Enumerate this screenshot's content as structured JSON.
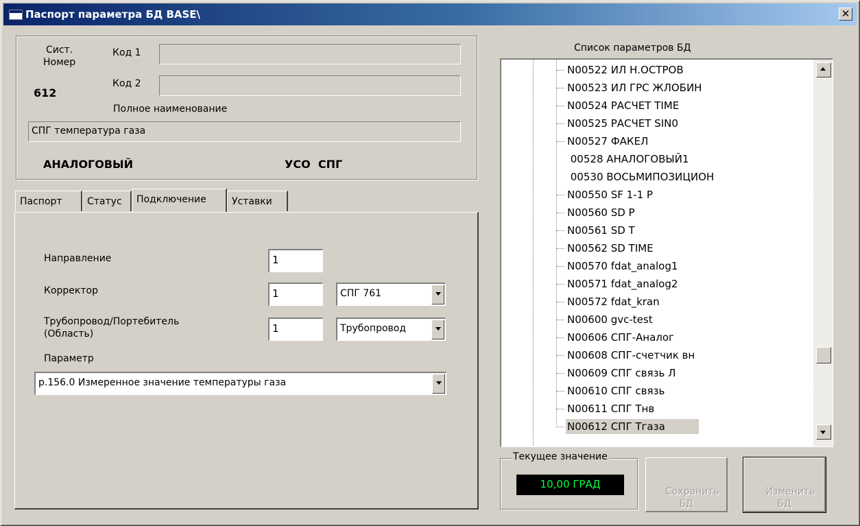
{
  "window": {
    "title": "Паспорт параметра БД BASE\\",
    "close_glyph": "✕",
    "title_icon": "window-icon"
  },
  "header": {
    "sys_number_label": "Сист.\nНомер",
    "sys_number_value": "612",
    "code1_label": "Код 1",
    "code1_value": "",
    "code2_label": "Код 2",
    "code2_value": "",
    "full_name_label": "Полное наименование",
    "full_name_value": "СПГ температура газа",
    "type_text": "АНАЛОГОВЫЙ",
    "uso_text": "УСО  СПГ"
  },
  "tabs": [
    {
      "label": "Паспорт",
      "active": false
    },
    {
      "label": "Статус",
      "active": false
    },
    {
      "label": "Подключение",
      "active": true
    },
    {
      "label": "Уставки",
      "active": false
    }
  ],
  "connection": {
    "direction_label": "Направление",
    "direction_value": "1",
    "corrector_label": "Корректор",
    "corrector_value": "1",
    "corrector_select": "СПГ 761",
    "pipeline_label": "Трубопровод/Портебитель\n(Область)",
    "pipeline_value": "1",
    "pipeline_select": "Трубопровод",
    "parameter_label": "Параметр",
    "parameter_select": "p.156.0 Измеренное значение температуры газа"
  },
  "param_list": {
    "title": "Список параметров БД",
    "items": [
      {
        "label": "N00522 ИЛ Н.ОСТРОВ",
        "dash": true
      },
      {
        "label": "N00523 ИЛ ГРС ЖЛОБИН",
        "dash": true
      },
      {
        "label": "N00524 РАСЧЕТ TIME",
        "dash": true
      },
      {
        "label": "N00525 РАСЧЕТ SIN0",
        "dash": true
      },
      {
        "label": "N00527 ФАКЕЛ",
        "dash": true
      },
      {
        "label": " 00528 АНАЛОГОВЫЙ1",
        "dash": false
      },
      {
        "label": " 00530 ВОСЬМИПОЗИЦИОН",
        "dash": false
      },
      {
        "label": "N00550 SF 1-1 P",
        "dash": true
      },
      {
        "label": "N00560 SD P",
        "dash": true
      },
      {
        "label": "N00561 SD T",
        "dash": true
      },
      {
        "label": "N00562 SD TIME",
        "dash": true
      },
      {
        "label": "N00570 fdat_analog1",
        "dash": true
      },
      {
        "label": "N00571 fdat_analog2",
        "dash": true
      },
      {
        "label": "N00572 fdat_kran",
        "dash": true
      },
      {
        "label": "N00600 gvc-test",
        "dash": true
      },
      {
        "label": "N00606 СПГ-Аналог",
        "dash": true
      },
      {
        "label": "N00608 СПГ-счетчик вн",
        "dash": true
      },
      {
        "label": "N00609 СПГ связь Л",
        "dash": true
      },
      {
        "label": "N00610 СПГ связь",
        "dash": true
      },
      {
        "label": "N00611 СПГ Тнв",
        "dash": true
      },
      {
        "label": "N00612 СПГ Тгаза",
        "dash": true,
        "selected": true
      }
    ]
  },
  "current_value": {
    "label": "Текущее значение",
    "value": "10,00 ГРАД",
    "value_color": "#00ff40"
  },
  "buttons": {
    "save_label": "Сохранить\nБД",
    "change_label": "Изменить\nБД",
    "enabled": false
  },
  "colors": {
    "face": "#d4d0c8",
    "title_start": "#0a246a",
    "title_end": "#a6caf0"
  }
}
